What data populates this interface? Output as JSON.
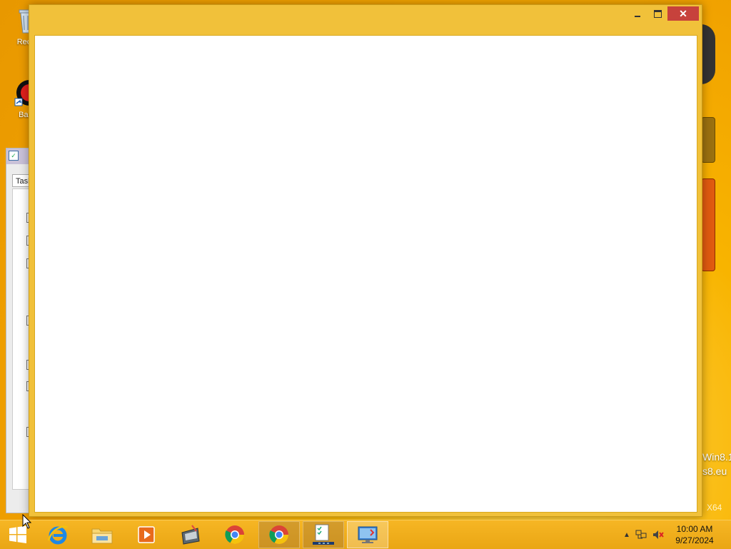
{
  "desktop": {
    "icons": [
      {
        "label": "Recyc",
        "icon": "recycle-bin-icon"
      },
      {
        "label": "Band",
        "icon": "bandicam-icon"
      }
    ],
    "background_window": {
      "tab_label": "Tasl"
    },
    "watermark": {
      "line1": "Win8.1",
      "line2": "s8.eu",
      "arch": "X64"
    }
  },
  "main_window": {
    "title": "",
    "controls": {
      "minimize": "minimize",
      "maximize": "maximize",
      "close": "✕"
    }
  },
  "taskbar": {
    "start": "start-icon",
    "pinned": [
      {
        "name": "internet-explorer",
        "icon": "internet-explorer-icon"
      },
      {
        "name": "file-explorer",
        "icon": "folder-icon"
      },
      {
        "name": "media-player",
        "icon": "media-player-icon"
      },
      {
        "name": "utility",
        "icon": "toolbox-icon"
      },
      {
        "name": "chrome",
        "icon": "chrome-icon"
      },
      {
        "name": "chrome-running",
        "icon": "chrome-icon"
      },
      {
        "name": "task-checklist",
        "icon": "checklist-icon"
      },
      {
        "name": "remote-desktop",
        "icon": "monitor-icon"
      }
    ],
    "tray": {
      "time": "10:00 AM",
      "date": "9/27/2024"
    }
  },
  "colors": {
    "accent": "#f0a400",
    "close": "#c7423c",
    "window_frame": "#f1c13a"
  }
}
